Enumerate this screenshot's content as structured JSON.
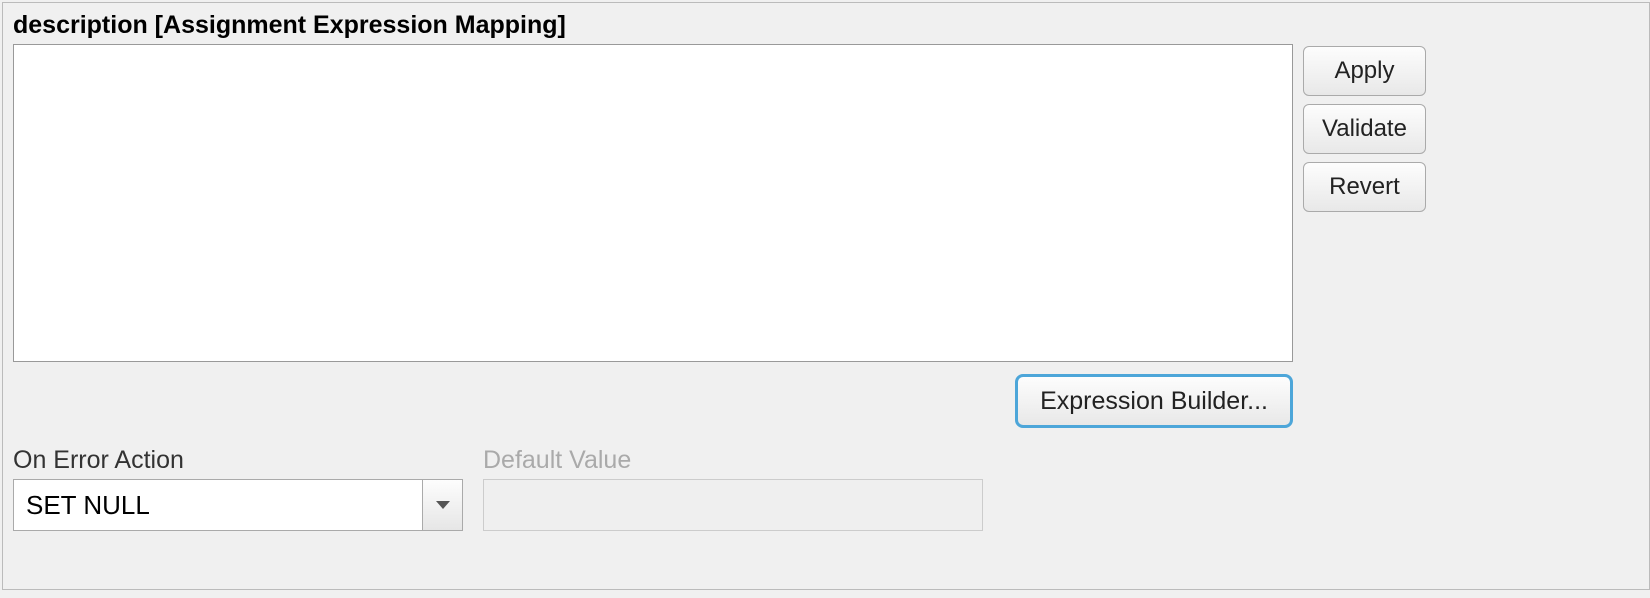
{
  "header": {
    "title": "description   [Assignment Expression Mapping]"
  },
  "expression": {
    "value": ""
  },
  "buttons": {
    "apply": "Apply",
    "validate": "Validate",
    "revert": "Revert",
    "expression_builder": "Expression Builder..."
  },
  "on_error": {
    "label": "On Error Action",
    "selected": "SET NULL"
  },
  "default_value": {
    "label": "Default Value",
    "value": "",
    "disabled": true
  }
}
